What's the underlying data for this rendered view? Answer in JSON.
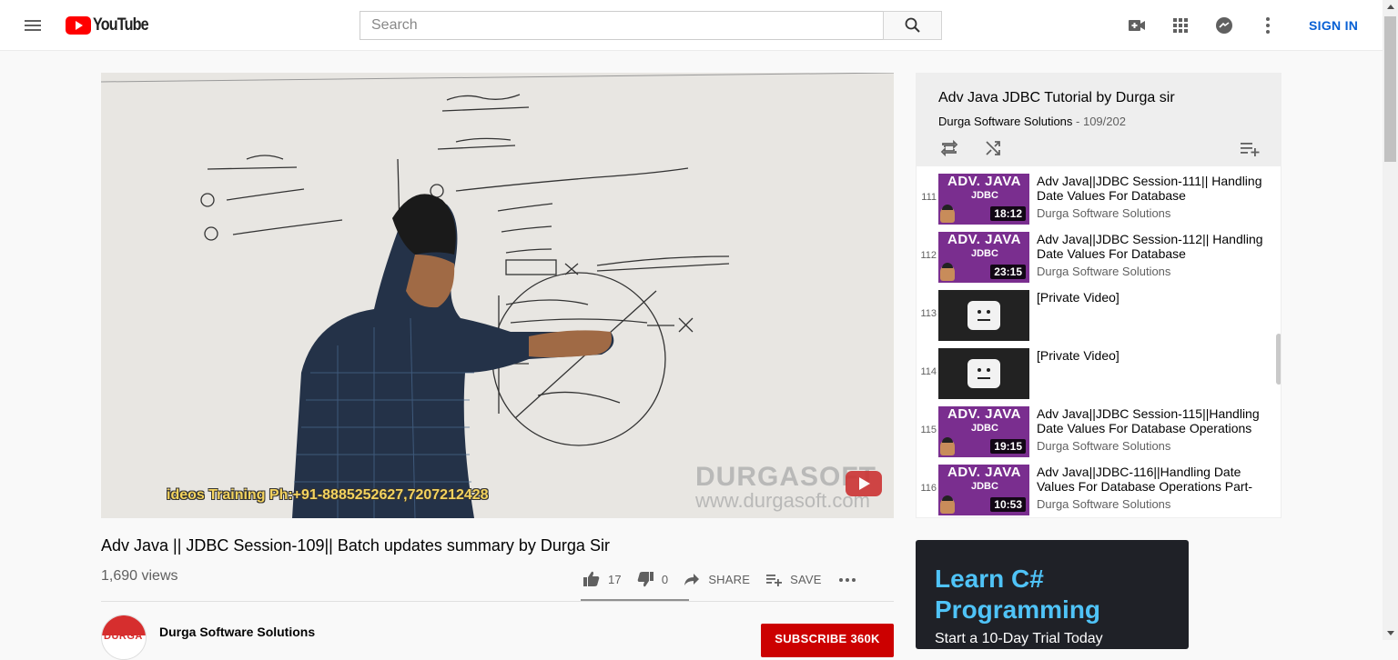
{
  "masthead": {
    "logo_text": "YouTube",
    "search_placeholder": "Search",
    "sign_in": "SIGN IN",
    "icons": [
      "menu-icon",
      "youtube-logo-icon",
      "search-icon",
      "create-video-icon",
      "apps-grid-icon",
      "messages-icon",
      "more-vert-icon"
    ]
  },
  "player": {
    "watermark_line1": "DURGASOFT",
    "watermark_line2": "www.durgasoft.com",
    "training_text": "ideos Training Ph:+91-8885252627,7207212428"
  },
  "video": {
    "title": "Adv Java || JDBC Session-109|| Batch updates summary by Durga Sir",
    "views": "1,690 views",
    "likes": "17",
    "dislikes": "0",
    "share_label": "SHARE",
    "save_label": "SAVE",
    "channel_name": "Durga Software Solutions",
    "avatar_text": "DURGA",
    "subscribe_label": "SUBSCRIBE 360K"
  },
  "playlist": {
    "title": "Adv Java JDBC Tutorial by Durga sir",
    "channel": "Durga Software Solutions",
    "position": " - 109/202",
    "items": [
      {
        "index": "111",
        "title": "Adv Java||JDBC Session-111|| Handling Date Values For Database",
        "channel": "Durga Software Solutions",
        "duration": "18:12",
        "thumb_adv": "ADV. JAVA",
        "thumb_jdbc": "JDBC"
      },
      {
        "index": "112",
        "title": "Adv Java||JDBC Session-112|| Handling Date Values For Database",
        "channel": "Durga Software Solutions",
        "duration": "23:15",
        "thumb_adv": "ADV. JAVA",
        "thumb_jdbc": "JDBC"
      },
      {
        "index": "113",
        "title": "[Private Video]"
      },
      {
        "index": "114",
        "title": "[Private Video]"
      },
      {
        "index": "115",
        "title": "Adv Java||JDBC Session-115||Handling Date Values For Database Operations",
        "channel": "Durga Software Solutions",
        "duration": "19:15",
        "thumb_adv": "ADV. JAVA",
        "thumb_jdbc": "JDBC"
      },
      {
        "index": "116",
        "title": "Adv Java||JDBC-116||Handling Date Values For Database Operations Part-",
        "channel": "Durga Software Solutions",
        "duration": "10:53",
        "thumb_adv": "ADV. JAVA",
        "thumb_jdbc": "JDBC"
      }
    ]
  },
  "ad": {
    "title": "Learn C# Programming",
    "subtitle": "Start a 10-Day Trial Today"
  },
  "colors": {
    "brand_red": "#ff0000",
    "link_blue": "#065fd4",
    "subscribe_red": "#cc0000",
    "thumb_purple": "#7a2e8f",
    "ad_blue": "#4fc3f7"
  }
}
